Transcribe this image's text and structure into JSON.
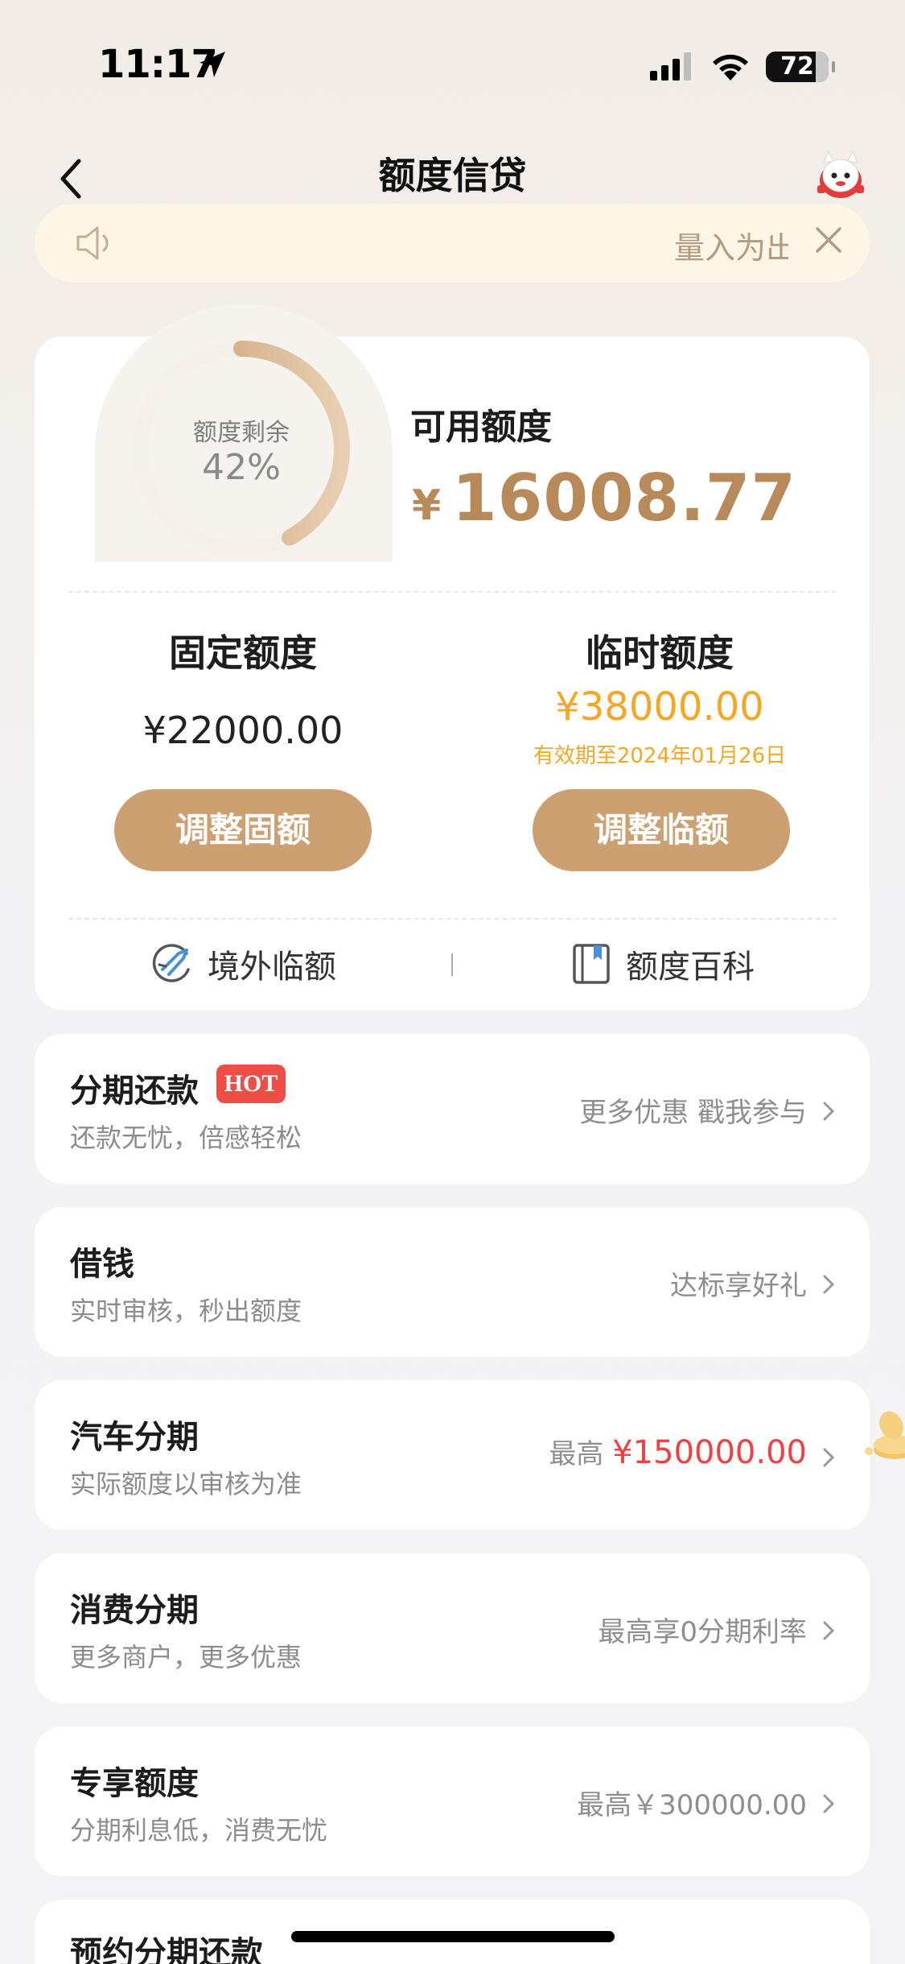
{
  "status_bar": {
    "time": "11:17",
    "battery": "72"
  },
  "nav": {
    "title": "额度信贷"
  },
  "notice": {
    "text": "量入为出"
  },
  "credit": {
    "ring_label": "额度剩余",
    "ring_value": "42%",
    "remaining_fraction": 0.42,
    "available_label": "可用额度",
    "available_currency": "¥",
    "available_amount": "16008.77",
    "fixed_title": "固定额度",
    "fixed_amount": "¥22000.00",
    "fixed_button": "调整固额",
    "temp_title": "临时额度",
    "temp_amount": "¥38000.00",
    "temp_valid": "有效期至2024年01月26日",
    "temp_button": "调整临额",
    "overseas_link": "境外临额",
    "wiki_link": "额度百科"
  },
  "items": [
    {
      "title": "分期还款",
      "badge": "HOT",
      "subtitle": "还款无忧，倍感轻松",
      "right": "更多优惠 戳我参与"
    },
    {
      "title": "借钱",
      "subtitle": "实时审核，秒出额度",
      "right": "达标享好礼"
    },
    {
      "title": "汽车分期",
      "subtitle": "实际额度以审核为准",
      "right_prefix": "最高",
      "right_amount": "¥150000.00"
    },
    {
      "title": "消费分期",
      "subtitle": "更多商户，更多优惠",
      "right": "最高享0分期利率"
    },
    {
      "title": "专享额度",
      "subtitle": "分期利息低，消费无忧",
      "right": "最高￥300000.00"
    },
    {
      "title": "预约分期还款"
    }
  ],
  "colors": {
    "accent_brown": "#b98a59",
    "button_brown": "#cda072",
    "temp_orange": "#f5a623",
    "hot_red": "#ee4e46",
    "amount_red": "#f23f3f"
  }
}
